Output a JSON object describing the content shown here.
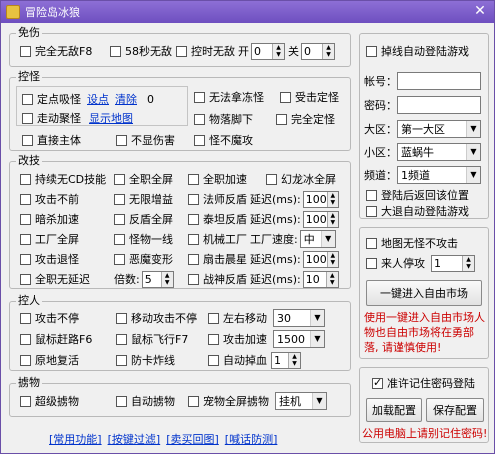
{
  "window": {
    "title": "冒险岛冰狼",
    "close": "✕"
  },
  "mianshang": {
    "title": "免伤",
    "full_invincible": "完全无敌F8",
    "invincible_58": "58秒无敌",
    "timed_invincible": "控时无敌",
    "open_label": "开",
    "open_value": "0",
    "close_label": "关",
    "close_value": "0"
  },
  "kongguai": {
    "title": "控怪",
    "fixed_suck": "定点吸怪",
    "set_point": "设点",
    "clear": "清除",
    "count": "0",
    "walk_gather": "走动聚怪",
    "show_map": "显示地图",
    "direct_body": "直接主体",
    "no_show_damage": "不显伤害",
    "no_freeze": "无法拿冻怪",
    "hit_freeze": "受击定怪",
    "drop_under": "物落脚下",
    "full_freeze": "完全定怪",
    "no_attack": "怪不魔攻"
  },
  "gaishu": {
    "title": "改技",
    "rows": [
      [
        "持续无CD技能",
        "全职全屏",
        "全职加速",
        "幻龙冰全屏"
      ],
      [
        "攻击不前",
        "无限增益",
        "法师反盾",
        "延迟(ms):",
        "100"
      ],
      [
        "暗杀加速",
        "反盾全屏",
        "泰坦反盾",
        "延迟(ms):",
        "100"
      ],
      [
        "工厂全屏",
        "怪物一线",
        "机械工厂",
        "工厂速度:",
        "中"
      ],
      [
        "攻击退怪",
        "恶魔变形",
        "扇击晨星",
        "延迟(ms):",
        "100"
      ],
      [
        "全职无延迟",
        "倍数:",
        "5",
        "战神反盾",
        "延迟(ms):",
        "10"
      ]
    ]
  },
  "kongren": {
    "title": "控人",
    "attack_no_stop": "攻击不停",
    "move_attack": "移动攻击不停",
    "lr_move": "左右移动",
    "lr_value": "30",
    "mouse_chase": "鼠标赶路F6",
    "mouse_fly": "鼠标飞行F7",
    "attack_speed": "攻击加速",
    "attack_speed_value": "1500",
    "revive": "原地复活",
    "anti_jam": "防卡炸线",
    "auto_blood": "自动掉血",
    "auto_blood_value": "1"
  },
  "luewu": {
    "title": "掳物",
    "super_loot": "超级掳物",
    "auto_loot": "自动掳物",
    "pet_loot": "宠物全屏掳物",
    "mode": "挂机"
  },
  "bottom": {
    "links": [
      "[常用功能]",
      "[按键过滤]",
      "[卖买回图]",
      "[喊话防测]"
    ]
  },
  "login": {
    "auto_relogin": "掉线自动登陆游戏",
    "account_label": "帐号：",
    "password_label": "密码：",
    "region_label": "大区：",
    "region_value": "第一大区",
    "subregion_label": "小区：",
    "subregion_value": "蓝蜗牛",
    "channel_label": "频道：",
    "channel_value": "1频道",
    "back_to_spot": "登陆后返回该位置",
    "auto_relogin_big": "大退自动登陆游戏"
  },
  "market": {
    "no_attack_map": "地图无怪不攻击",
    "player_stop": "来人停攻",
    "player_stop_value": "1",
    "enter_button": "一键进入自由市场",
    "warning": "使用一键进入自由市场人物也自由市场将在勇部落, 请谨慎使用!"
  },
  "config": {
    "remember_password": "准许记住密码登陆",
    "load_button": "加载配置",
    "save_button": "保存配置",
    "footer_red": "公用电脑上请别记住密码!"
  },
  "colors": {
    "title_bar": "#7a5bcc",
    "warning": "#cc0000",
    "link": "#0033cc"
  }
}
